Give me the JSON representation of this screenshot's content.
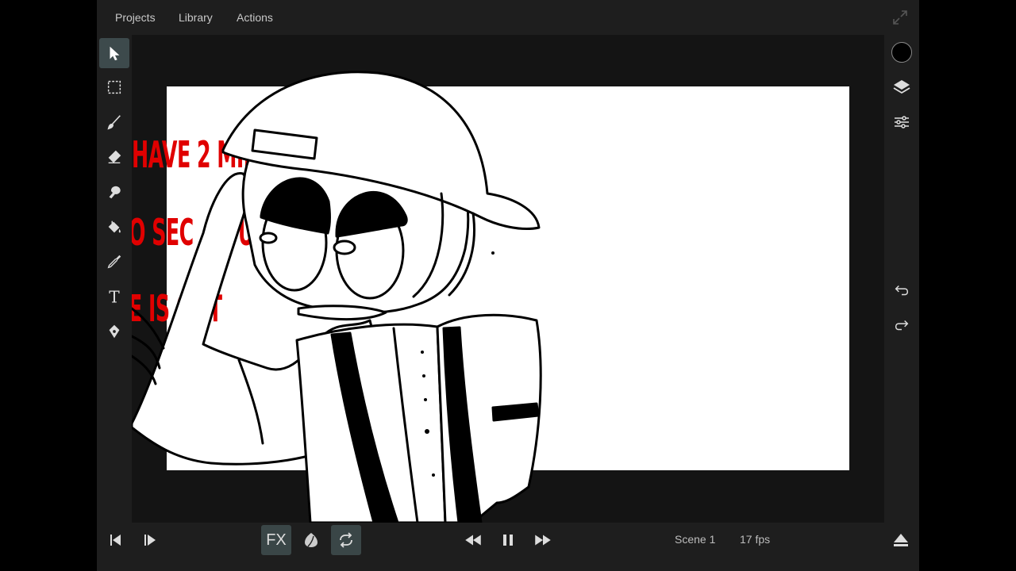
{
  "menu": {
    "projects": "Projects",
    "library": "Library",
    "actions": "Actions"
  },
  "canvas_text": {
    "line1": "HAVE 2 MINU",
    "line2": "O SEC",
    "line2b": "S U",
    "line3": "E IS OUT"
  },
  "bottom": {
    "fx_label": "FX",
    "scene_label": "Scene 1",
    "fps_label": "17 fps"
  },
  "colors": {
    "accent_active": "#3d4a4c",
    "caption_red": "#e00000",
    "current_color": "#000000"
  },
  "icons": {
    "left_toolbar": [
      "select-arrow-icon",
      "lasso-selection-icon",
      "brush-icon",
      "eraser-icon",
      "smudge-icon",
      "fill-bucket-icon",
      "eyedropper-icon",
      "text-icon",
      "pen-tool-icon"
    ],
    "right_toolbar": [
      "color-swatch-icon",
      "layers-icon",
      "adjustments-icon",
      "undo-icon",
      "redo-icon"
    ],
    "bottom_toolbar": [
      "previous-frame-icon",
      "next-frame-icon",
      "onion-skin-icon",
      "loop-icon",
      "rewind-icon",
      "pause-icon",
      "fast-forward-icon",
      "eject-icon"
    ]
  }
}
